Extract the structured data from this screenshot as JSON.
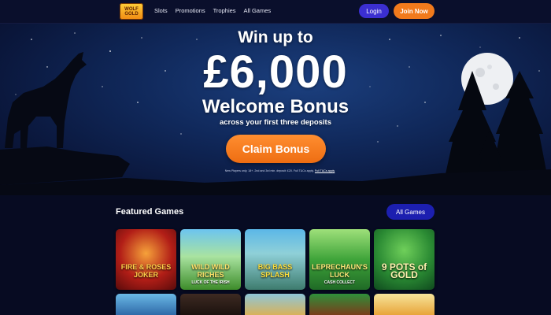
{
  "nav": {
    "logo_text": "WOLF GOLD",
    "links": [
      "Slots",
      "Promotions",
      "Trophies",
      "All Games"
    ],
    "login_label": "Login",
    "join_label": "Join Now"
  },
  "hero": {
    "line1": "Win up to",
    "amount": "£6,000",
    "line3": "Welcome Bonus",
    "line4": "across your first three deposits",
    "cta_label": "Claim Bonus",
    "terms": "New Players only. 18+. 2nd and 3rd min. deposit: £20. Full T&Cs apply.",
    "terms_link": "Full T&Cs apply"
  },
  "featured": {
    "title": "Featured Games",
    "all_games_label": "All Games",
    "games": [
      {
        "title": "FIRE & ROSES JOKER",
        "subtitle": ""
      },
      {
        "title": "WILD WILD RICHES",
        "subtitle": "LUCK OF THE IRISH"
      },
      {
        "title": "BIG BASS SPLASH",
        "subtitle": ""
      },
      {
        "title": "LEPRECHAUN'S LUCK",
        "subtitle": "CASH COLLECT"
      },
      {
        "title": "9 POTS of GOLD",
        "subtitle": ""
      }
    ]
  },
  "colors": {
    "accent_orange": "#f17a1c",
    "login_blue": "#3b2fd1",
    "page_bg": "#070b22"
  }
}
